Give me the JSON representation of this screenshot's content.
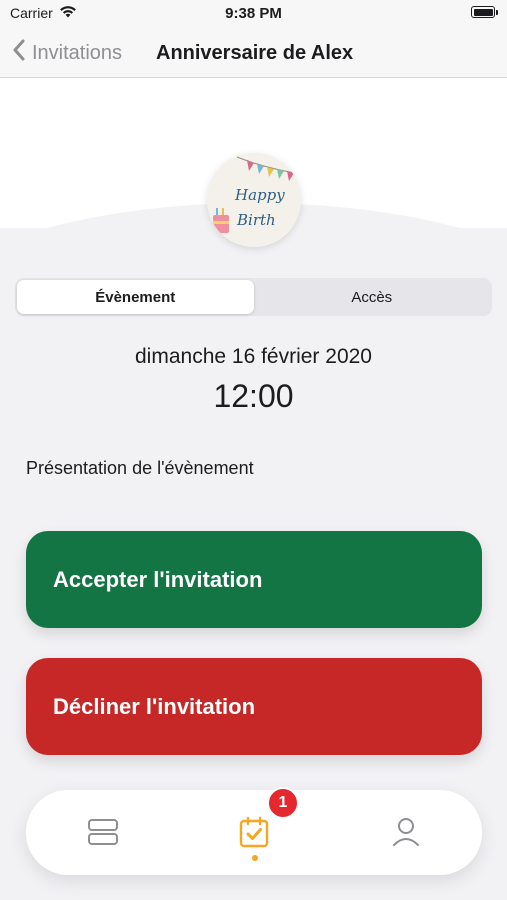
{
  "status_bar": {
    "carrier": "Carrier",
    "time": "9:38 PM",
    "icons": [
      "wifi-icon",
      "battery-icon"
    ]
  },
  "nav": {
    "back_label": "Invitations",
    "title": "Anniversaire de Alex"
  },
  "event_image": {
    "line1": "Happy",
    "line2": "Birth"
  },
  "segments": [
    {
      "label": "Évènement",
      "selected": true
    },
    {
      "label": "Accès",
      "selected": false
    }
  ],
  "event": {
    "date": "dimanche 16 février 2020",
    "time": "12:00",
    "presentation_label": "Présentation de l'évènement"
  },
  "actions": {
    "accept_label": "Accepter l'invitation",
    "decline_label": "Décliner l'invitation"
  },
  "tab_bar": {
    "items": [
      {
        "icon": "list-icon",
        "selected": false
      },
      {
        "icon": "calendar-check-icon",
        "selected": true
      },
      {
        "icon": "profile-icon",
        "selected": false
      }
    ],
    "badge_count": "1"
  },
  "colors": {
    "accept": "#137444",
    "decline": "#c62828",
    "accent": "#f5a623",
    "badge": "#e5282e",
    "background": "#f2f2f5"
  }
}
